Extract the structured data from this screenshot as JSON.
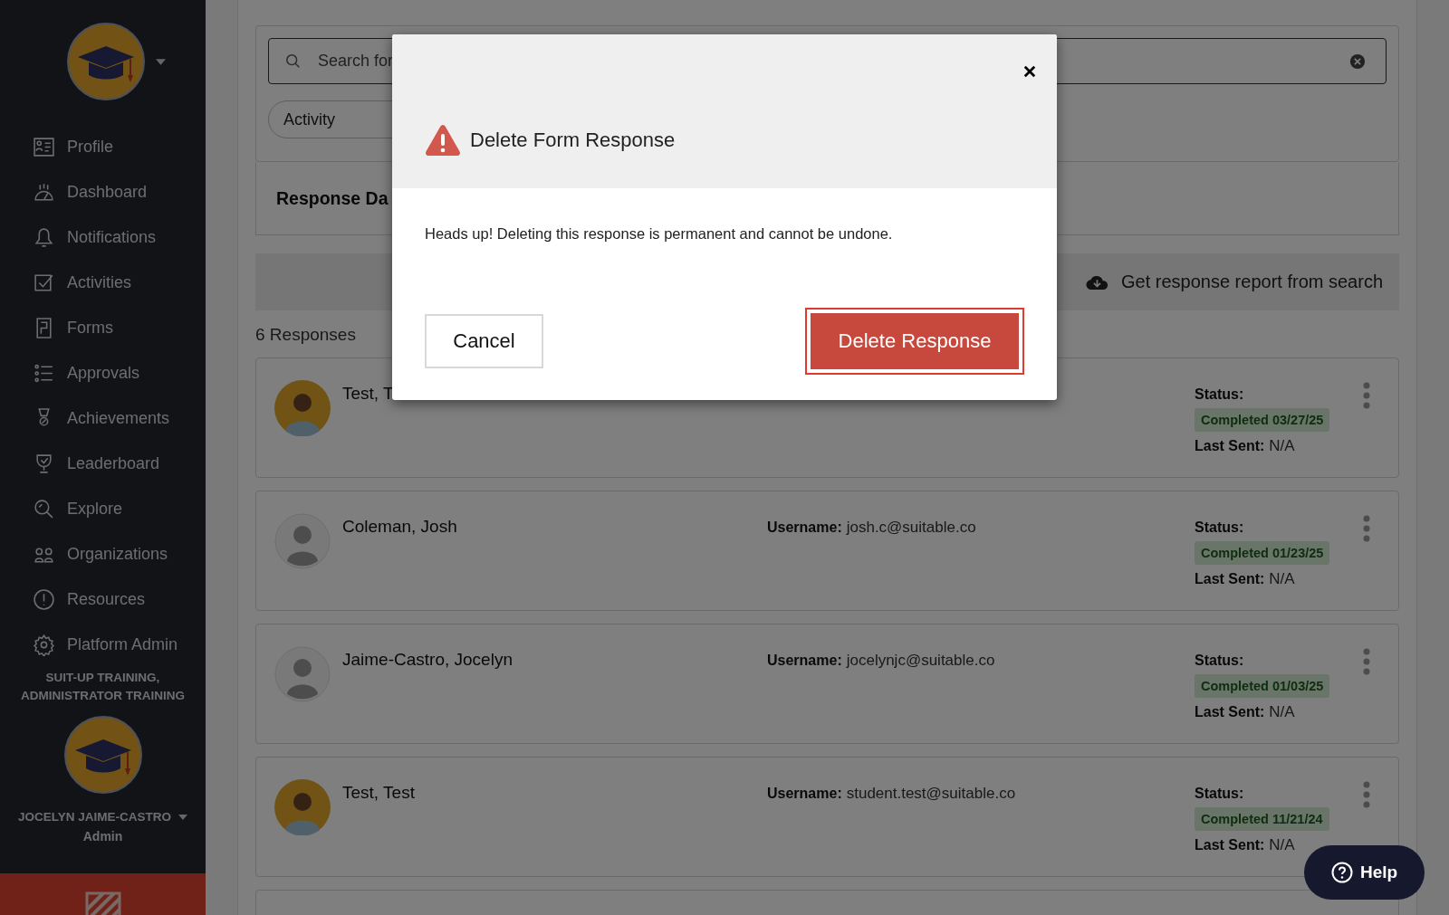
{
  "sidebar": {
    "nav": [
      {
        "label": "Profile"
      },
      {
        "label": "Dashboard"
      },
      {
        "label": "Notifications"
      },
      {
        "label": "Activities"
      },
      {
        "label": "Forms"
      },
      {
        "label": "Approvals"
      },
      {
        "label": "Achievements"
      },
      {
        "label": "Leaderboard"
      },
      {
        "label": "Explore"
      },
      {
        "label": "Organizations"
      },
      {
        "label": "Resources"
      },
      {
        "label": "Platform Admin"
      }
    ],
    "organization": "SUIT-UP TRAINING, ADMINISTRATOR TRAINING",
    "user": {
      "name": "JOCELYN JAIME-CASTRO",
      "role": "Admin"
    }
  },
  "search": {
    "placeholder": "Search for"
  },
  "filter_chip": "Activity",
  "section_title": "Response Da",
  "report_button": "Get response report from search",
  "count": "6 Responses",
  "responses": [
    {
      "name": "Test, T",
      "avatar": {
        "kind": "photo"
      },
      "status_label": "Status:",
      "status": "Completed 03/27/25",
      "last_sent_label": "Last Sent:",
      "last_sent": "N/A"
    },
    {
      "name": "Coleman, Josh",
      "avatar": {
        "kind": "default"
      },
      "username_label": "Username:",
      "username": "josh.c@suitable.co",
      "status_label": "Status:",
      "status": "Completed 01/23/25",
      "last_sent_label": "Last Sent:",
      "last_sent": "N/A"
    },
    {
      "name": "Jaime-Castro, Jocelyn",
      "avatar": {
        "kind": "default"
      },
      "username_label": "Username:",
      "username": "jocelynjc@suitable.co",
      "status_label": "Status:",
      "status": "Completed 01/03/25",
      "last_sent_label": "Last Sent:",
      "last_sent": "N/A"
    },
    {
      "name": "Test, Test",
      "avatar": {
        "kind": "photo"
      },
      "username_label": "Username:",
      "username": "student.test@suitable.co",
      "status_label": "Status:",
      "status": "Completed 11/21/24",
      "last_sent_label": "Last Sent:",
      "last_sent": "N/A"
    }
  ],
  "modal": {
    "title": "Delete Form Response",
    "message": "Heads up! Deleting this response is permanent and cannot be undone.",
    "cancel": "Cancel",
    "confirm": "Delete Response"
  },
  "help": "Help"
}
